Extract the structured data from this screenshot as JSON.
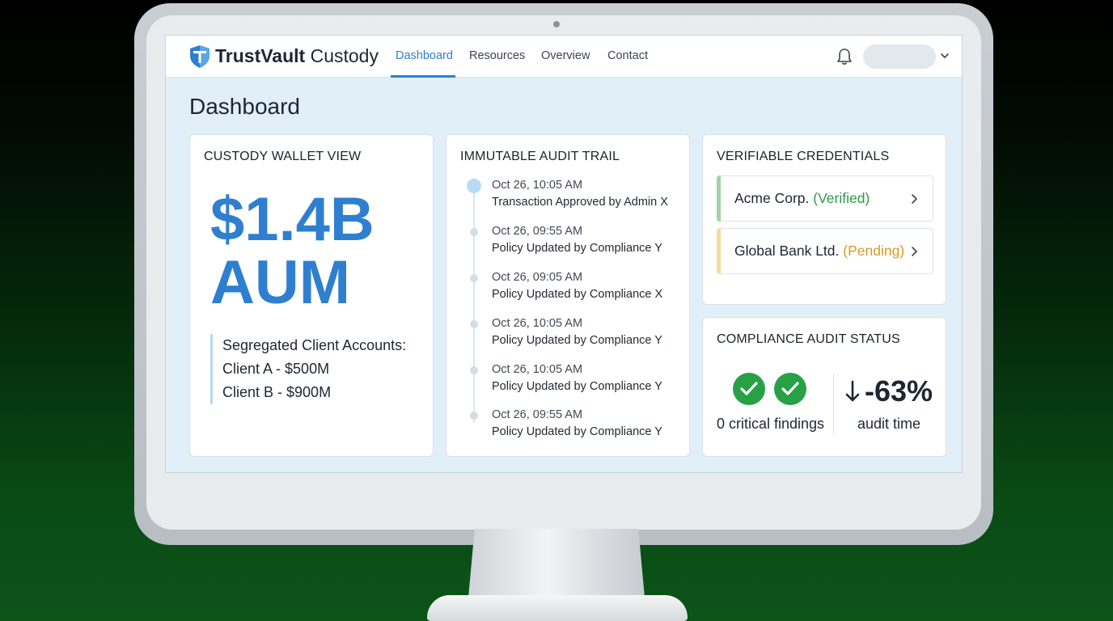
{
  "brand": {
    "name_bold": "TrustVault",
    "name_light": "Custody",
    "logo_icon": "shield-logo-icon"
  },
  "nav": {
    "items": [
      {
        "label": "Dashboard",
        "active": true
      },
      {
        "label": "Resources",
        "active": false
      },
      {
        "label": "Overview",
        "active": false
      },
      {
        "label": "Contact",
        "active": false
      }
    ],
    "notification_icon": "bell-icon",
    "user_menu_icon": "chevron-down-icon"
  },
  "page": {
    "title": "Dashboard"
  },
  "wallet": {
    "title": "CUSTODY WALLET VIEW",
    "amount": "$1.4B",
    "unit": "AUM",
    "segregated_heading": "Segregated Client Accounts:",
    "clients": [
      "Client A - $500M",
      "Client B - $900M"
    ]
  },
  "audit_trail": {
    "title": "IMMUTABLE AUDIT TRAIL",
    "entries": [
      {
        "time": "Oct 26, 10:05 AM",
        "text": "Transaction Approved by Admin X"
      },
      {
        "time": "Oct 26, 09:55 AM",
        "text": "Policy Updated by Compliance Y"
      },
      {
        "time": "Oct 26, 09:05 AM",
        "text": "Policy Updated by Compliance X"
      },
      {
        "time": "Oct 26, 10:05 AM",
        "text": "Policy Updated by Compliance Y"
      },
      {
        "time": "Oct 26, 10:05 AM",
        "text": "Policy Updated by Compliance Y"
      },
      {
        "time": "Oct 26, 09:55 AM",
        "text": "Policy Updated by Compliance Y"
      }
    ]
  },
  "credentials": {
    "title": "VERIFIABLE CREDENTIALS",
    "items": [
      {
        "name": "Acme Corp.",
        "status": "(Verified)",
        "color": "#2e9a4a"
      },
      {
        "name": "Global Bank Ltd.",
        "status": "(Pending)",
        "color": "#d89a2a"
      }
    ]
  },
  "compliance": {
    "title": "COMPLIANCE AUDIT STATUS",
    "findings_label": "0 critical findings",
    "change_value": "-63%",
    "change_label": "audit time"
  },
  "colors": {
    "accent": "#2f7fd0",
    "success": "#27a046",
    "pending": "#d89a2a"
  }
}
